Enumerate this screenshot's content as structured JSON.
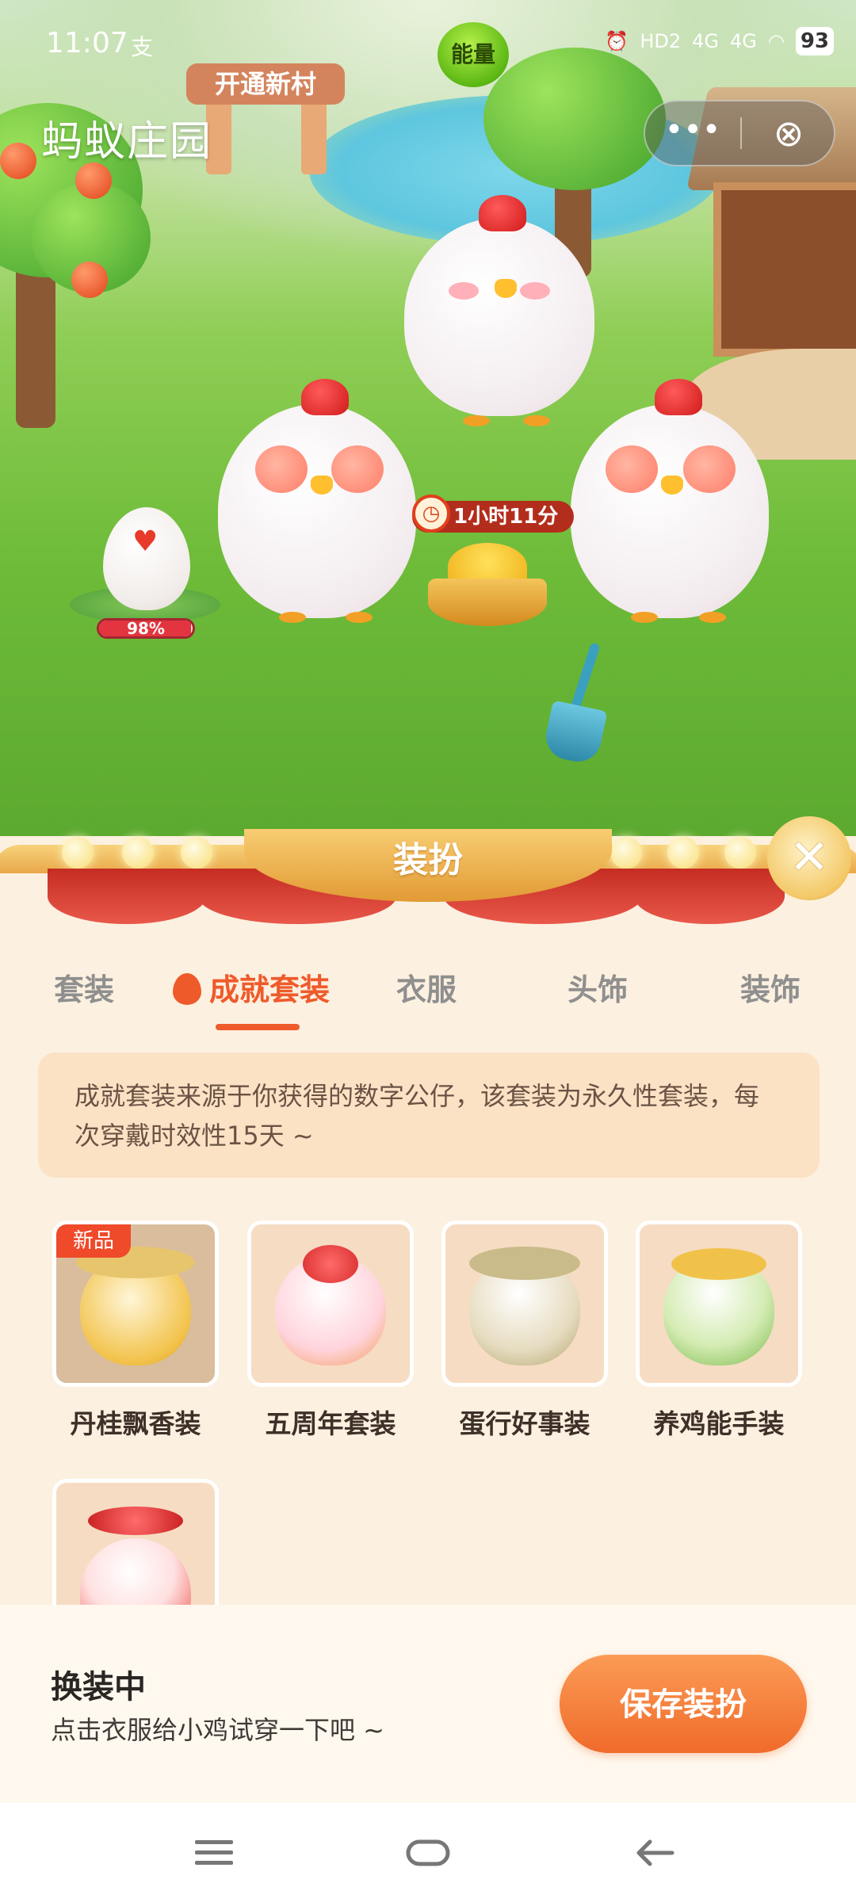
{
  "status_bar": {
    "time": "11:07",
    "alipay_glyph": "支",
    "energy_label": "能量",
    "network_hd": "HD2",
    "network_4g_1": "4G",
    "network_4g_2": "4G",
    "battery": "93"
  },
  "app": {
    "title": "蚂蚁庄园",
    "more_glyph": "•••",
    "close_glyph": "⊗"
  },
  "scene": {
    "village_sign": "开通新村",
    "timer": "1小时11分",
    "egg_progress": "98%",
    "egg_progress_value": 0.98
  },
  "panel": {
    "title": "装扮",
    "close_glyph": "✕",
    "tabs": [
      {
        "label": "套装",
        "active": false
      },
      {
        "label": "成就套装",
        "active": true
      },
      {
        "label": "衣服",
        "active": false
      },
      {
        "label": "头饰",
        "active": false
      },
      {
        "label": "装饰",
        "active": false
      }
    ],
    "notice": "成就套装来源于你获得的数字公仔，该套装为永久性套装，每次穿戴时效性15天 ~",
    "items": [
      {
        "label": "丹桂飘香装",
        "badge": "新品"
      },
      {
        "label": "五周年套装"
      },
      {
        "label": "蛋行好事装"
      },
      {
        "label": "养鸡能手装"
      },
      {
        "label": ""
      }
    ]
  },
  "footer": {
    "title": "换装中",
    "subtitle": "点击衣服给小鸡试穿一下吧 ~",
    "save_label": "保存装扮"
  },
  "colors": {
    "accent": "#ef5a2b",
    "save_button": "#f06b2b",
    "panel_bg": "#fcf0e0",
    "notice_bg": "#fbe2c5"
  },
  "icons": {
    "nav_menu": "menu-icon",
    "nav_home": "home-icon",
    "nav_back": "back-icon"
  }
}
